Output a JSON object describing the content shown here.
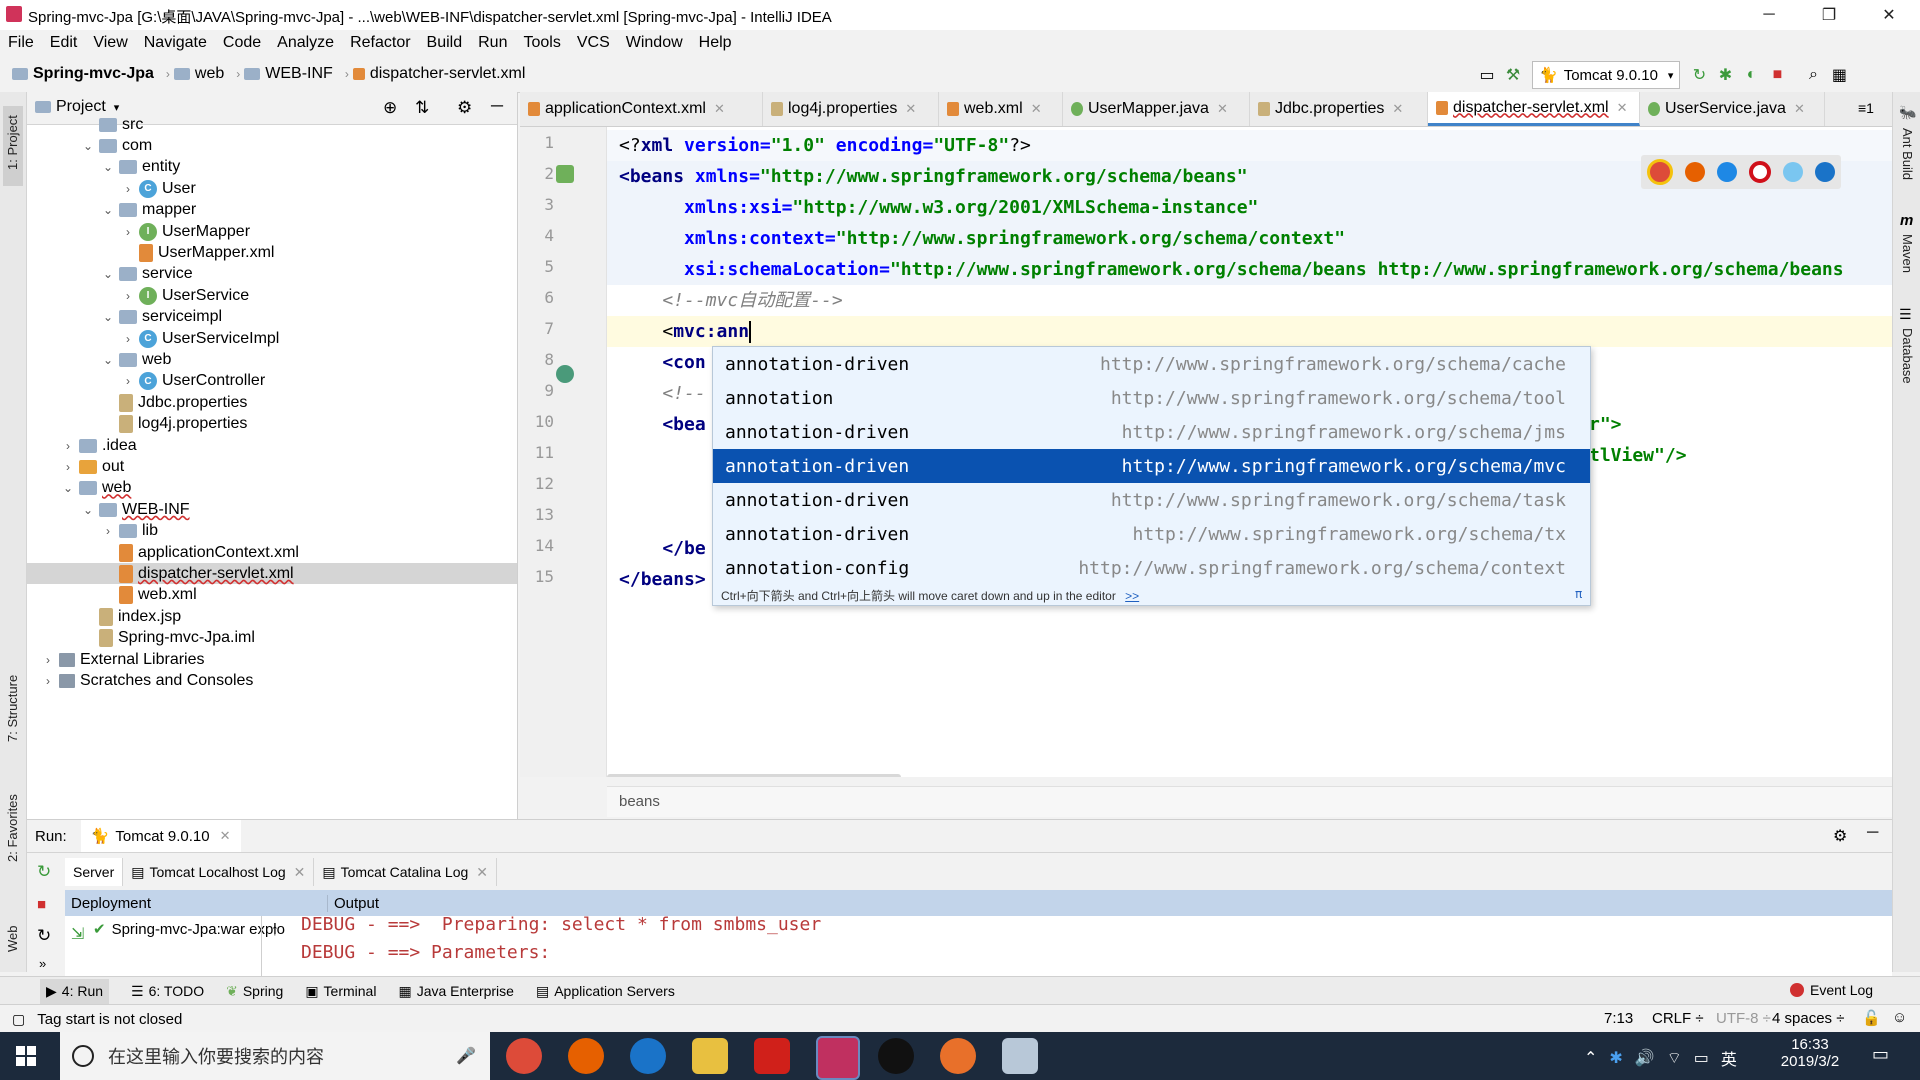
{
  "window": {
    "title": "Spring-mvc-Jpa [G:\\桌面\\JAVA\\Spring-mvc-Jpa] - ...\\web\\WEB-INF\\dispatcher-servlet.xml [Spring-mvc-Jpa] - IntelliJ IDEA",
    "minimize": "─",
    "restore": "❐",
    "close": "✕"
  },
  "menu": [
    "File",
    "Edit",
    "View",
    "Navigate",
    "Code",
    "Analyze",
    "Refactor",
    "Build",
    "Run",
    "Tools",
    "VCS",
    "Window",
    "Help"
  ],
  "nav": {
    "crumbs": [
      "Spring-mvc-Jpa",
      "web",
      "WEB-INF",
      "dispatcher-servlet.xml"
    ],
    "run_config": "Tomcat 9.0.10"
  },
  "left_stripe": {
    "project": "1: Project",
    "structure": "7: Structure",
    "favorites": "2: Favorites",
    "web": "Web"
  },
  "project_panel": {
    "title": "Project",
    "tree": [
      {
        "label": "src",
        "arrow": "",
        "icon": "folder"
      },
      {
        "label": "com",
        "arrow": "⌄",
        "icon": "folder"
      },
      {
        "label": "entity",
        "arrow": "⌄",
        "icon": "folder"
      },
      {
        "label": "User",
        "arrow": "›",
        "icon": "class"
      },
      {
        "label": "mapper",
        "arrow": "⌄",
        "icon": "folder"
      },
      {
        "label": "UserMapper",
        "arrow": "›",
        "icon": "interface"
      },
      {
        "label": "UserMapper.xml",
        "arrow": "",
        "icon": "xml"
      },
      {
        "label": "service",
        "arrow": "⌄",
        "icon": "folder"
      },
      {
        "label": "UserService",
        "arrow": "›",
        "icon": "interface"
      },
      {
        "label": "serviceimpl",
        "arrow": "⌄",
        "icon": "folder"
      },
      {
        "label": "UserServiceImpl",
        "arrow": "›",
        "icon": "class"
      },
      {
        "label": "web",
        "arrow": "⌄",
        "icon": "folder"
      },
      {
        "label": "UserController",
        "arrow": "›",
        "icon": "class"
      },
      {
        "label": "Jdbc.properties",
        "arrow": "",
        "icon": "file"
      },
      {
        "label": "log4j.properties",
        "arrow": "",
        "icon": "file"
      },
      {
        "label": ".idea",
        "arrow": "›",
        "icon": "folder"
      },
      {
        "label": "out",
        "arrow": "›",
        "icon": "folder-orange"
      },
      {
        "label": "web",
        "arrow": "⌄",
        "icon": "folder"
      },
      {
        "label": "WEB-INF",
        "arrow": "⌄",
        "icon": "folder"
      },
      {
        "label": "lib",
        "arrow": "›",
        "icon": "folder"
      },
      {
        "label": "applicationContext.xml",
        "arrow": "",
        "icon": "xml"
      },
      {
        "label": "dispatcher-servlet.xml",
        "arrow": "",
        "icon": "xml"
      },
      {
        "label": "web.xml",
        "arrow": "",
        "icon": "xml"
      },
      {
        "label": "index.jsp",
        "arrow": "",
        "icon": "file"
      },
      {
        "label": "Spring-mvc-Jpa.iml",
        "arrow": "",
        "icon": "file"
      },
      {
        "label": "External Libraries",
        "arrow": "›",
        "icon": "lib"
      },
      {
        "label": "Scratches and Consoles",
        "arrow": "›",
        "icon": "lib"
      }
    ]
  },
  "tabs": [
    {
      "label": "applicationContext.xml",
      "active": false
    },
    {
      "label": "log4j.properties",
      "active": false
    },
    {
      "label": "web.xml",
      "active": false
    },
    {
      "label": "UserMapper.java",
      "active": false
    },
    {
      "label": "Jdbc.properties",
      "active": false
    },
    {
      "label": "dispatcher-servlet.xml",
      "active": true
    },
    {
      "label": "UserService.java",
      "active": false
    }
  ],
  "tabs_overflow": "≡1",
  "editor": {
    "line_numbers": [
      "1",
      "2",
      "3",
      "4",
      "5",
      "6",
      "7",
      "8",
      "9",
      "10",
      "11",
      "12",
      "13",
      "14",
      "15"
    ],
    "code": {
      "l1_a": "<?",
      "l1_b": "xml ",
      "l1_c": "version",
      "l1_d": "=",
      "l1_e": "\"1.0\" ",
      "l1_f": "encoding",
      "l1_g": "=",
      "l1_h": "\"UTF-8\"",
      "l1_i": "?>",
      "l2_a": "<",
      "l2_b": "beans ",
      "l2_c": "xmlns",
      "l2_d": "=",
      "l2_e": "\"http://www.springframework.org/schema/beans\"",
      "l3_a": "      xmlns:xsi",
      "l3_b": "=",
      "l3_c": "\"http://www.w3.org/2001/XMLSchema-instance\"",
      "l4_a": "      xmlns:context",
      "l4_b": "=",
      "l4_c": "\"http://www.springframework.org/schema/context\"",
      "l5_a": "      xsi:schemaLocation",
      "l5_b": "=",
      "l5_c": "\"http://www.springframework.org/schema/beans http://www.springframework.org/schema/beans",
      "l6": "    <!--mvc自动配置-->",
      "l7_a": "    <",
      "l7_b": "mvc:ann",
      "l8": "    <con",
      "l9": "    <!--",
      "l10": "    <bea",
      "l10_r": "r\">",
      "l11_r": "tlView\"/>",
      "l14": "    </be",
      "l15_a": "</",
      "l15_b": "beans",
      "l15_c": ">"
    },
    "breadcrumb": "beans"
  },
  "autocomplete": {
    "items": [
      {
        "name": "annotation-driven",
        "ns": "http://www.springframework.org/schema/cache"
      },
      {
        "name": "annotation",
        "ns": "http://www.springframework.org/schema/tool"
      },
      {
        "name": "annotation-driven",
        "ns": "http://www.springframework.org/schema/jms"
      },
      {
        "name": "annotation-driven",
        "ns": "http://www.springframework.org/schema/mvc"
      },
      {
        "name": "annotation-driven",
        "ns": "http://www.springframework.org/schema/task"
      },
      {
        "name": "annotation-driven",
        "ns": "http://www.springframework.org/schema/tx"
      },
      {
        "name": "annotation-config",
        "ns": "http://www.springframework.org/schema/context"
      }
    ],
    "selected_index": 3,
    "hint": "Ctrl+向下箭头 and Ctrl+向上箭头 will move caret down and up in the editor",
    "hint_link": ">>",
    "pi": "π"
  },
  "right_stripe": {
    "ant": "Ant Build",
    "maven": "Maven",
    "database": "Database"
  },
  "run_panel": {
    "label": "Run:",
    "config_tab": "Tomcat 9.0.10",
    "subtabs": [
      "Server",
      "Tomcat Localhost Log",
      "Tomcat Catalina Log"
    ],
    "deployment_header": "Deployment",
    "output_header": "Output",
    "deployment_item": "Spring-mvc-Jpa:war explo",
    "output_lines": [
      "DEBUG - ==>  Preparing: select * from smbms_user",
      "DEBUG - ==> Parameters: "
    ]
  },
  "bottom_tools": [
    "4: Run",
    "6: TODO",
    "Spring",
    "Terminal",
    "Java Enterprise",
    "Application Servers"
  ],
  "event_log": "Event Log",
  "status": {
    "message": "Tag start is not closed",
    "position": "7:13",
    "line_sep": "CRLF ÷",
    "encoding": "UTF-8 ÷",
    "indent": "4 spaces ÷"
  },
  "taskbar": {
    "search_placeholder": "在这里输入你要搜索的内容",
    "time": "16:33",
    "date": "2019/3/2",
    "ime": "英"
  },
  "colors": {
    "accent": "#0a52b0",
    "tag": "#000080",
    "attr": "#0000ff",
    "value": "#008000",
    "comment": "#808080"
  }
}
